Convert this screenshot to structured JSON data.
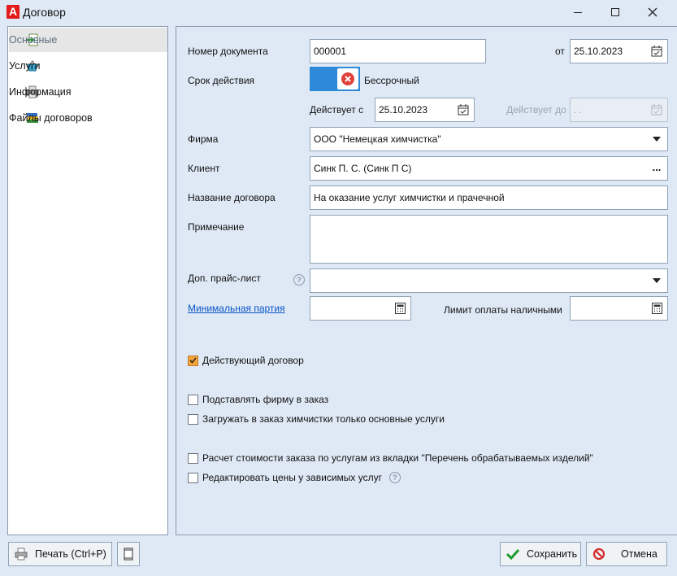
{
  "window": {
    "title": "Договор",
    "logo_letter": "A"
  },
  "sidebar": {
    "items": [
      {
        "label": "Основные",
        "icon": "import-arrow-icon",
        "active": true
      },
      {
        "label": "Услуги",
        "icon": "basket-icon",
        "active": false
      },
      {
        "label": "Информация",
        "icon": "printer-icon",
        "active": false
      },
      {
        "label": "Файлы договоров",
        "icon": "books-icon",
        "active": false
      }
    ]
  },
  "form": {
    "doc_number_label": "Номер документа",
    "doc_number": "000001",
    "from_label": "от",
    "from_date": "25.10.2023",
    "term_label": "Срок действия",
    "term_toggle_label": "Бессрочный",
    "valid_from_label": "Действует с",
    "valid_from": "25.10.2023",
    "valid_to_label": "Действует до",
    "valid_to": " .  .",
    "firm_label": "Фирма",
    "firm": "ООО \"Немецкая химчистка\"",
    "client_label": "Клиент",
    "client": "Синк П. С. (Синк П С)",
    "client_more": "...",
    "contract_name_label": "Название договора",
    "contract_name": "На оказание услуг химчистки и прачечной",
    "note_label": "Примечание",
    "note": "",
    "price_list_label": "Доп. прайс-лист",
    "price_list": "",
    "min_batch_link": "Минимальная партия",
    "min_batch": "",
    "cash_limit_label": "Лимит оплаты наличными",
    "cash_limit": "",
    "help_glyph": "?"
  },
  "checks": [
    {
      "label": "Действующий договор",
      "checked": true
    },
    {
      "label": "Подставлять фирму в заказ",
      "checked": false
    },
    {
      "label": "Загружать в заказ химчистки только основные услуги",
      "checked": false
    },
    {
      "label": "Расчет стоимости заказа по услугам из вкладки \"Перечень обрабатываемых изделий\"",
      "checked": false
    },
    {
      "label": "Редактировать цены у зависимых услуг",
      "checked": false
    }
  ],
  "buttons": {
    "print": "Печать (Ctrl+P)",
    "save": "Сохранить",
    "cancel": "Отмена"
  },
  "colors": {
    "accent": "#2d8ad8",
    "link": "#0b55c9",
    "check_orange": "#f3a43a"
  }
}
